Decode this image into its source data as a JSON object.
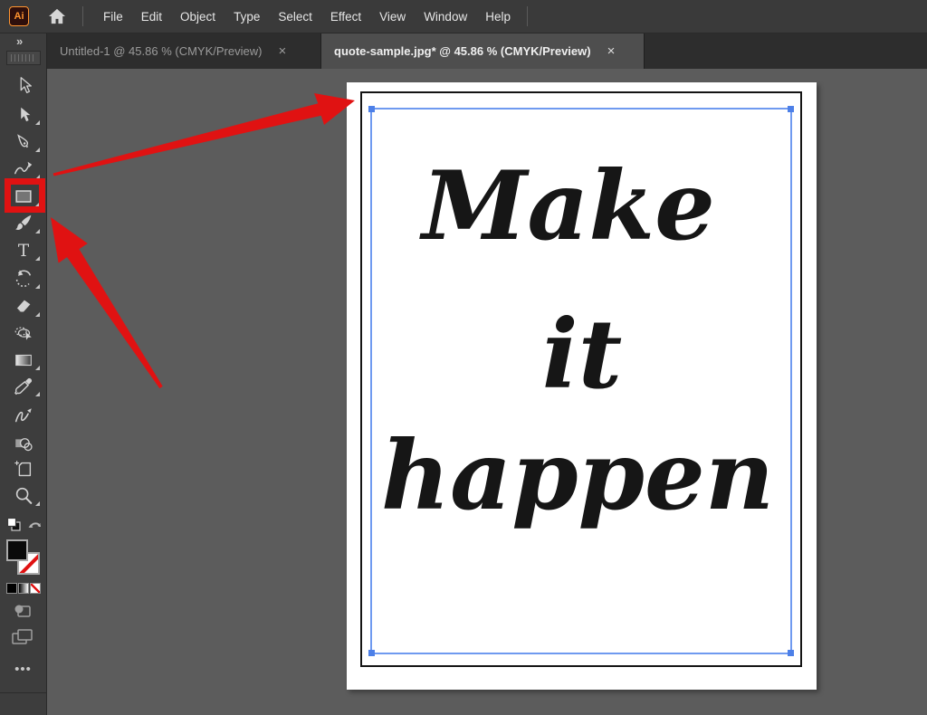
{
  "app": {
    "logo_text": "Ai"
  },
  "menu_bar": {
    "items": [
      "File",
      "Edit",
      "Object",
      "Type",
      "Select",
      "Effect",
      "View",
      "Window",
      "Help"
    ]
  },
  "tab_bar": {
    "expand_glyph": "»",
    "tabs": [
      {
        "label": "Untitled-1 @ 45.86 % (CMYK/Preview)",
        "close_glyph": "×",
        "active": false
      },
      {
        "label": "quote-sample.jpg* @ 45.86 % (CMYK/Preview)",
        "close_glyph": "×",
        "active": true
      }
    ]
  },
  "toolbar": {
    "tools": [
      "selection",
      "direct-selection",
      "pen",
      "curvature",
      "rectangle",
      "paintbrush",
      "type",
      "rotate",
      "eraser",
      "shape-builder",
      "gradient",
      "eyedropper",
      "shaper",
      "symbols",
      "artboard",
      "zoom"
    ],
    "highlighted_tool": "rectangle",
    "type_tool_glyph": "T",
    "more_glyph": "•••"
  },
  "canvas": {
    "quote": [
      "Make",
      "it",
      "happen"
    ]
  },
  "colors": {
    "annotation_red": "#e01212",
    "selection_blue": "#6f9af0",
    "canvas_gray": "#5c5c5c",
    "panel_gray": "#3d3d3d",
    "menubar_gray": "#3a3a3a",
    "tabstrip_dark": "#2d2d2d",
    "active_tab_gray": "#4e4e4e",
    "logo_orange": "#ff9430",
    "artboard_white": "#ffffff",
    "ink_black": "#161616"
  }
}
